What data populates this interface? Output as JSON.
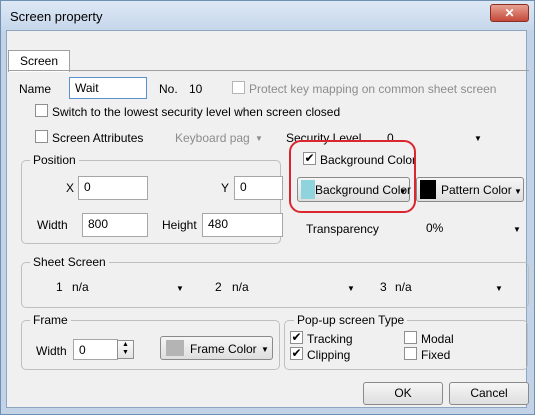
{
  "window": {
    "title": "Screen property",
    "close_glyph": "✕"
  },
  "tabs": [
    {
      "label": "Screen"
    }
  ],
  "screen": {
    "name_label": "Name",
    "name_value": "Wait",
    "no_label": "No.",
    "no_value": "10",
    "protect_label": "Protect key mapping on common sheet screen",
    "switch_security_label": "Switch to the lowest security level when screen closed",
    "attributes_label": "Screen Attributes",
    "keyboard_value": "Keyboard pag",
    "security_level_label": "Security Level",
    "security_level_value": "0"
  },
  "position": {
    "title": "Position",
    "x_label": "X",
    "x_value": "0",
    "y_label": "Y",
    "y_value": "0",
    "width_label": "Width",
    "width_value": "800",
    "height_label": "Height",
    "height_value": "480"
  },
  "background": {
    "checkbox_label": "Background Color",
    "checked": true,
    "color_button_label": "Background Color",
    "pattern_button_label": "Pattern Color",
    "transparency_label": "Transparency",
    "transparency_value": "0%",
    "colors": {
      "background_swatch": "#8fd3dc",
      "pattern_swatch": "#000000",
      "highlight": "#d9262f"
    }
  },
  "sheet_screen": {
    "title": "Sheet Screen",
    "slots": [
      {
        "number": "1",
        "value": "n/a"
      },
      {
        "number": "2",
        "value": "n/a"
      },
      {
        "number": "3",
        "value": "n/a"
      }
    ]
  },
  "frame": {
    "title": "Frame",
    "width_label": "Width",
    "width_value": "0",
    "color_button_label": "Frame Color",
    "swatch_color": "#b4b4b4"
  },
  "popup": {
    "title": "Pop-up screen Type",
    "tracking_label": "Tracking",
    "tracking_checked": true,
    "modal_label": "Modal",
    "modal_checked": false,
    "clipping_label": "Clipping",
    "clipping_checked": true,
    "fixed_label": "Fixed",
    "fixed_checked": false
  },
  "buttons": {
    "ok": "OK",
    "cancel": "Cancel"
  },
  "glyphs": {
    "check": "✔",
    "dropdown": "▼",
    "spin_up": "▲",
    "spin_down": "▼"
  }
}
